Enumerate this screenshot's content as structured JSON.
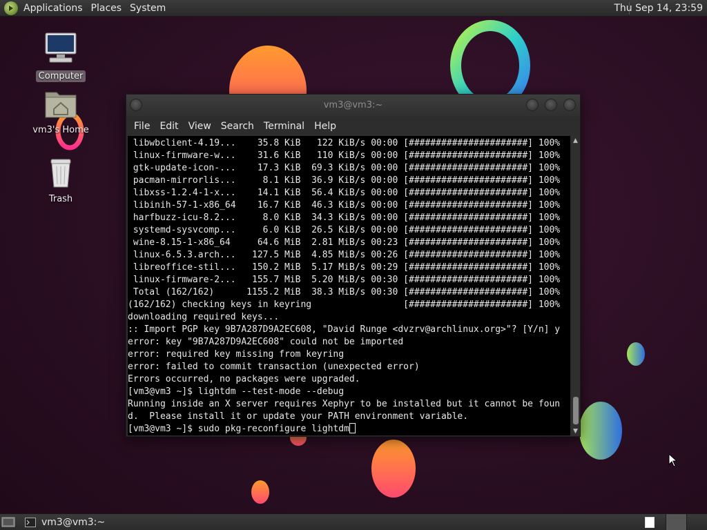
{
  "top_panel": {
    "menus": [
      "Applications",
      "Places",
      "System"
    ],
    "clock": "Thu Sep 14, 23:59"
  },
  "desktop": {
    "icons": [
      {
        "label": "Computer",
        "icon": "computer-icon"
      },
      {
        "label": "vm3's Home",
        "icon": "home-folder-icon"
      },
      {
        "label": "Trash",
        "icon": "trash-icon"
      }
    ]
  },
  "terminal": {
    "title": "vm3@vm3:~",
    "menus": [
      "File",
      "Edit",
      "View",
      "Search",
      "Terminal",
      "Help"
    ],
    "lines": [
      " libwbclient-4.19...    35.8 KiB   122 KiB/s 00:00 [######################] 100%",
      " linux-firmware-w...    31.6 KiB   110 KiB/s 00:00 [######################] 100%",
      " gtk-update-icon-...    17.3 KiB  69.3 KiB/s 00:00 [######################] 100%",
      " pacman-mirrorlis...     8.1 KiB  36.9 KiB/s 00:00 [######################] 100%",
      " libxss-1.2.4-1-x...    14.1 KiB  56.4 KiB/s 00:00 [######################] 100%",
      " libinih-57-1-x86_64    16.7 KiB  46.3 KiB/s 00:00 [######################] 100%",
      " harfbuzz-icu-8.2...     8.0 KiB  34.3 KiB/s 00:00 [######################] 100%",
      " systemd-sysvcomp...     6.0 KiB  26.5 KiB/s 00:00 [######################] 100%",
      " wine-8.15-1-x86_64     64.6 MiB  2.81 MiB/s 00:23 [######################] 100%",
      " linux-6.5.3.arch...   127.5 MiB  4.85 MiB/s 00:26 [######################] 100%",
      " libreoffice-stil...   150.2 MiB  5.17 MiB/s 00:29 [######################] 100%",
      " linux-firmware-2...   155.7 MiB  5.20 MiB/s 00:30 [######################] 100%",
      " Total (162/162)      1155.2 MiB  38.3 MiB/s 00:30 [######################] 100%",
      "(162/162) checking keys in keyring                 [######################] 100%",
      "downloading required keys...",
      ":: Import PGP key 9B7A287D9A2EC608, \"David Runge <dvzrv@archlinux.org>\"? [Y/n] y",
      "error: key \"9B7A287D9A2EC608\" could not be imported",
      "error: required key missing from keyring",
      "error: failed to commit transaction (unexpected error)",
      "Errors occurred, no packages were upgraded.",
      "[vm3@vm3 ~]$ lightdm --test-mode --debug",
      "Running inside an X server requires Xephyr to be installed but it cannot be foun",
      "d.  Please install it or update your PATH environment variable."
    ],
    "prompt": "[vm3@vm3 ~]$ ",
    "current_input": "sudo pkg-reconfigure lightdm"
  },
  "bottom_panel": {
    "task_label": "vm3@vm3:~"
  },
  "colors": {
    "accent_orange": "#ff7a3d",
    "accent_cyan": "#3fc4e8",
    "terminal_bg": "#000000"
  }
}
